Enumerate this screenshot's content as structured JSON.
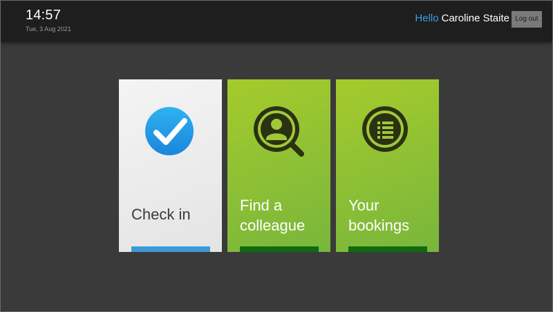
{
  "header": {
    "time": "14:57",
    "date": "Tue, 3 Aug 2021",
    "greeting_hello": "Hello",
    "user_name": "Caroline Staite",
    "logout_label": "Log out"
  },
  "tiles": [
    {
      "line1": "Check in",
      "line2": "",
      "icon": "checkmark-circle-icon",
      "bar_color": "#3b9ad6"
    },
    {
      "line1": "Find a",
      "line2": "colleague",
      "icon": "person-search-icon",
      "bar_color": "#0e6a0e"
    },
    {
      "line1": "Your",
      "line2": "bookings",
      "icon": "list-icon",
      "bar_color": "#0e6a0e"
    }
  ],
  "colors": {
    "accent_blue": "#3aa0e0",
    "tile_green": "#8fc13a",
    "background": "#3a3a3a",
    "header": "#1e1e1e"
  }
}
